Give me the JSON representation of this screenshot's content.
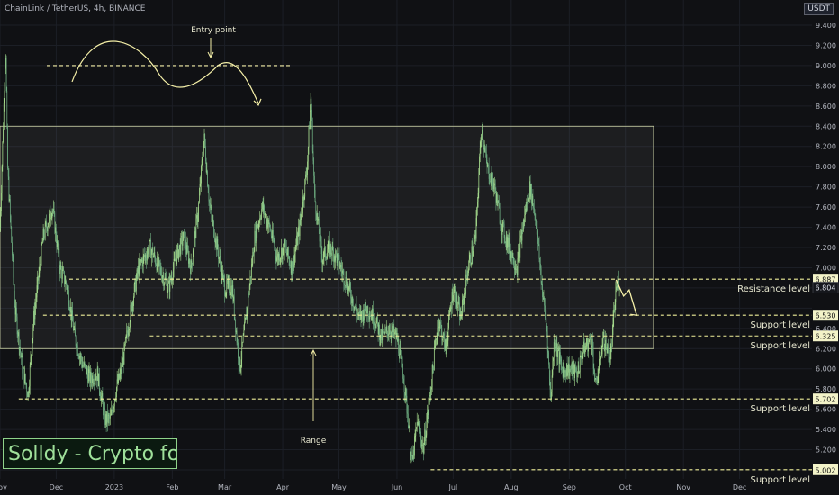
{
  "header": {
    "symbol": "ChainLink / TetherUS, 4h, BINANCE",
    "currency": "USDT"
  },
  "watermark": "Solldy - Crypto for U",
  "colors": {
    "candle": "#9bd38f",
    "level": "#f0f09a",
    "range": "#cfd6a8",
    "annotation": "#f5f0a8",
    "axis": "#b2b5be",
    "background": "#101114"
  },
  "chart_data": {
    "type": "candlestick",
    "ylim": [
      5.0,
      9.4
    ],
    "ylabels": [
      "9.400",
      "9.200",
      "9.000",
      "8.800",
      "8.600",
      "8.400",
      "8.200",
      "8.000",
      "7.800",
      "7.600",
      "7.400",
      "7.200",
      "7.000",
      "6.800",
      "6.600",
      "6.400",
      "6.200",
      "6.000",
      "5.800",
      "5.600",
      "5.400",
      "5.200",
      "5.000"
    ],
    "x_labels": [
      {
        "label": "Nov",
        "d": 0
      },
      {
        "label": "Dec",
        "d": 30
      },
      {
        "label": "2023",
        "d": 61
      },
      {
        "label": "Feb",
        "d": 92
      },
      {
        "label": "Mar",
        "d": 120
      },
      {
        "label": "Apr",
        "d": 151
      },
      {
        "label": "May",
        "d": 181
      },
      {
        "label": "Jun",
        "d": 212
      },
      {
        "label": "Jul",
        "d": 242
      },
      {
        "label": "Aug",
        "d": 273
      },
      {
        "label": "Sep",
        "d": 304
      },
      {
        "label": "Oct",
        "d": 334
      },
      {
        "label": "Nov",
        "d": 365
      },
      {
        "label": "Dec",
        "d": 395
      }
    ],
    "price_path": [
      [
        0,
        7.4
      ],
      [
        3,
        9.2
      ],
      [
        4,
        8.0
      ],
      [
        8,
        6.6
      ],
      [
        12,
        6.0
      ],
      [
        15,
        5.75
      ],
      [
        18,
        6.5
      ],
      [
        23,
        7.3
      ],
      [
        28,
        7.6
      ],
      [
        32,
        7.0
      ],
      [
        36,
        6.8
      ],
      [
        40,
        6.3
      ],
      [
        44,
        6.05
      ],
      [
        48,
        5.9
      ],
      [
        52,
        5.95
      ],
      [
        56,
        5.5
      ],
      [
        59,
        5.5
      ],
      [
        62,
        5.8
      ],
      [
        65,
        6.0
      ],
      [
        70,
        6.6
      ],
      [
        74,
        7.0
      ],
      [
        80,
        7.2
      ],
      [
        85,
        7.0
      ],
      [
        90,
        6.8
      ],
      [
        94,
        7.1
      ],
      [
        98,
        7.3
      ],
      [
        102,
        7.0
      ],
      [
        106,
        7.6
      ],
      [
        109,
        8.3
      ],
      [
        112,
        7.6
      ],
      [
        116,
        7.2
      ],
      [
        120,
        6.8
      ],
      [
        124,
        6.8
      ],
      [
        128,
        6.0
      ],
      [
        132,
        6.6
      ],
      [
        136,
        7.3
      ],
      [
        140,
        7.6
      ],
      [
        144,
        7.4
      ],
      [
        148,
        7.1
      ],
      [
        152,
        7.2
      ],
      [
        156,
        7.0
      ],
      [
        160,
        7.4
      ],
      [
        164,
        8.0
      ],
      [
        166,
        8.7
      ],
      [
        168,
        7.7
      ],
      [
        172,
        7.1
      ],
      [
        176,
        7.2
      ],
      [
        180,
        7.1
      ],
      [
        184,
        6.9
      ],
      [
        188,
        6.7
      ],
      [
        192,
        6.5
      ],
      [
        196,
        6.6
      ],
      [
        200,
        6.5
      ],
      [
        204,
        6.3
      ],
      [
        208,
        6.4
      ],
      [
        212,
        6.3
      ],
      [
        215,
        6.0
      ],
      [
        218,
        5.5
      ],
      [
        220,
        5.05
      ],
      [
        223,
        5.5
      ],
      [
        226,
        5.2
      ],
      [
        230,
        5.8
      ],
      [
        234,
        6.5
      ],
      [
        238,
        6.2
      ],
      [
        242,
        6.8
      ],
      [
        246,
        6.5
      ],
      [
        250,
        7.0
      ],
      [
        254,
        7.3
      ],
      [
        257,
        8.4
      ],
      [
        260,
        8.0
      ],
      [
        264,
        7.8
      ],
      [
        268,
        7.4
      ],
      [
        272,
        7.2
      ],
      [
        276,
        7.0
      ],
      [
        280,
        7.5
      ],
      [
        283,
        7.8
      ],
      [
        286,
        7.5
      ],
      [
        290,
        6.7
      ],
      [
        292,
        6.4
      ],
      [
        294,
        5.7
      ],
      [
        296,
        6.3
      ],
      [
        300,
        6.0
      ],
      [
        304,
        6.0
      ],
      [
        308,
        5.95
      ],
      [
        312,
        6.2
      ],
      [
        316,
        6.3
      ],
      [
        318,
        5.8
      ],
      [
        322,
        6.3
      ],
      [
        326,
        6.1
      ],
      [
        329,
        6.8
      ],
      [
        331,
        6.887
      ]
    ],
    "levels": [
      {
        "value": 6.887,
        "label": "Resistance level",
        "tag": "6.887",
        "x_start": 37
      },
      {
        "value": 6.53,
        "label": "Support level",
        "tag": "6.530",
        "x_start": 23
      },
      {
        "value": 6.325,
        "label": "Support level",
        "tag": "6.325",
        "x_start": 80
      },
      {
        "value": 5.702,
        "label": "Support level",
        "tag": "5.702",
        "x_start": 10
      },
      {
        "value": 5.002,
        "label": "Support level",
        "tag": "5.002",
        "x_start": 230
      }
    ],
    "current_price": {
      "value": 6.804,
      "tag": "6.804"
    },
    "range_box": {
      "x1": 0,
      "x2": 349,
      "y1": 8.4,
      "y2": 6.2,
      "label": "Range"
    },
    "entry_line": {
      "value": 9.0,
      "x1": 25,
      "x2": 136,
      "label": "Entry point"
    },
    "projection": [
      [
        329,
        6.88
      ],
      [
        333,
        6.72
      ],
      [
        336,
        6.78
      ],
      [
        340,
        6.53
      ]
    ]
  }
}
